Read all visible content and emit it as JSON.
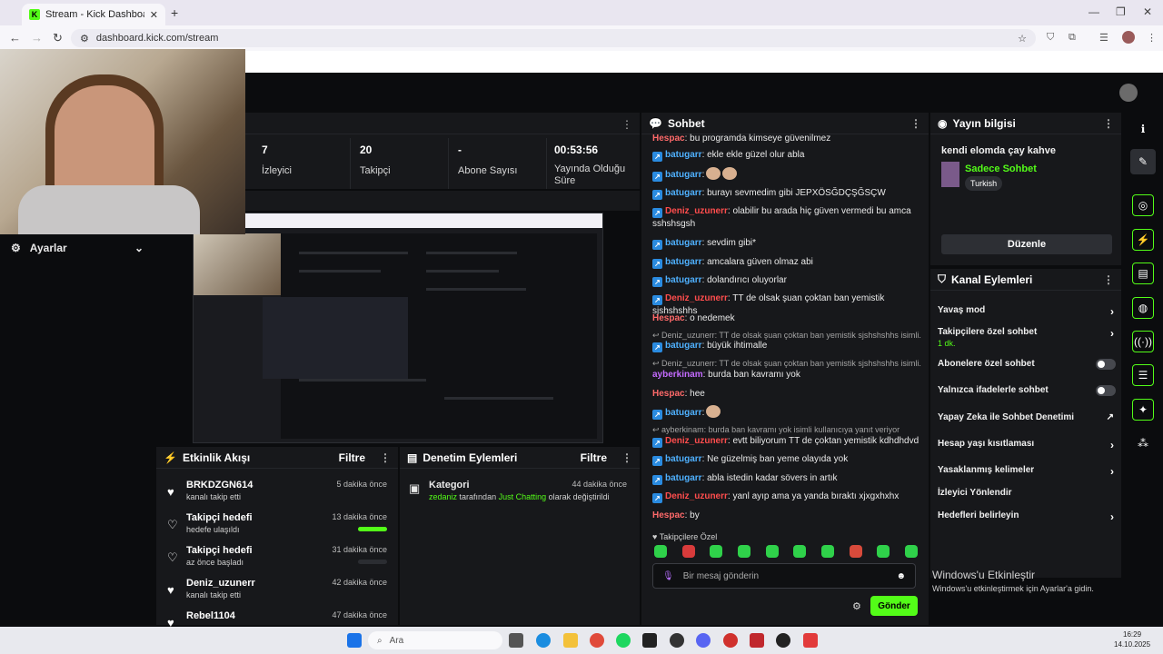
{
  "browser": {
    "tab_title": "Stream - Kick Dashboard",
    "url": "dashboard.kick.com/stream"
  },
  "stats": [
    {
      "value": "7",
      "label": "İzleyici"
    },
    {
      "value": "20",
      "label": "Takipçi"
    },
    {
      "value": "-",
      "label": "Abone Sayısı"
    },
    {
      "value": "00:53:56",
      "label": "Yayında Olduğu Süre"
    }
  ],
  "sidebar": {
    "settings_label": "Ayarlar"
  },
  "activity": {
    "title": "Etkinlik Akışı",
    "filter": "Filtre",
    "items": [
      {
        "name": "BRKDZGN614",
        "sub": "kanalı takip etti",
        "time": "5 dakika önce",
        "progress": null
      },
      {
        "name": "Takipçi hedefi",
        "sub": "hedefe ulaşıldı",
        "time": "13 dakika önce",
        "progress": 1.0
      },
      {
        "name": "Takipçi hedefi",
        "sub": "az önce başladı",
        "time": "31 dakika önce",
        "progress": 0.0
      },
      {
        "name": "Deniz_uzunerr",
        "sub": "kanalı takip etti",
        "time": "42 dakika önce",
        "progress": null
      },
      {
        "name": "Rebel1104",
        "sub": "",
        "time": "47 dakika önce",
        "progress": null
      }
    ]
  },
  "modactions": {
    "title": "Denetim Eylemleri",
    "filter": "Filtre",
    "item": {
      "name": "Kategori",
      "time": "44 dakika önce",
      "user": "zedaniz",
      "by": "tarafından",
      "category": "Just Chatting",
      "rest": "olarak değiştirildi"
    }
  },
  "chat": {
    "title": "Sohbet",
    "messages": [
      {
        "user": "Hespac",
        "cls": "u-hes",
        "badge": false,
        "text": ": bu programda kimseye güvenilmez"
      },
      {
        "user": "batugarr",
        "cls": "u-bat",
        "badge": true,
        "text": ": ekle ekle güzel olur abla"
      },
      {
        "user": "batugarr",
        "cls": "u-bat",
        "badge": true,
        "text": ":"
      },
      {
        "user": "batugarr",
        "cls": "u-bat",
        "badge": true,
        "text": ": burayı sevmedim gibi JEPXÖSĞDÇŞĞSÇW"
      },
      {
        "user": "Deniz_uzunerr",
        "cls": "u-den",
        "badge": true,
        "text": ": olabilir bu arada hiç güven vermedi bu amca sshshsgsh"
      },
      {
        "user": "batugarr",
        "cls": "u-bat",
        "badge": true,
        "text": ": sevdim gibi*"
      },
      {
        "user": "batugarr",
        "cls": "u-bat",
        "badge": true,
        "text": ": amcalara güven olmaz abi"
      },
      {
        "user": "batugarr",
        "cls": "u-bat",
        "badge": true,
        "text": ": dolandırıcı oluyorlar"
      },
      {
        "user": "Deniz_uzunerr",
        "cls": "u-den",
        "badge": true,
        "text": ": TT de olsak şuan çoktan ban yemistik sjshshshhs"
      },
      {
        "user": "Hespac",
        "cls": "u-hes",
        "badge": false,
        "text": ": o nedemek"
      },
      {
        "user": "batugarr",
        "cls": "u-bat",
        "badge": true,
        "text": ": büyük ihtimalle"
      },
      {
        "user": "ayberkinam",
        "cls": "u-ayb",
        "badge": false,
        "text": ": burda ban kavramı yok"
      },
      {
        "user": "Hespac",
        "cls": "u-hes",
        "badge": false,
        "text": ": hee"
      },
      {
        "user": "batugarr",
        "cls": "u-bat",
        "badge": true,
        "text": ":"
      },
      {
        "user": "Deniz_uzunerr",
        "cls": "u-den",
        "badge": true,
        "text": ": evtt biliyorum TT de çoktan yemistik kdhdhdvd"
      },
      {
        "user": "batugarr",
        "cls": "u-bat",
        "badge": true,
        "text": ": Ne güzelmiş ban yeme olayıda yok"
      },
      {
        "user": "batugarr",
        "cls": "u-bat",
        "badge": true,
        "text": ": abla istedin kadar sövers in artık"
      },
      {
        "user": "Deniz_uzunerr",
        "cls": "u-den",
        "badge": true,
        "text": ": yanl ayıp ama ya yanda bıraktı xjxgxhxhx"
      },
      {
        "user": "Hespac",
        "cls": "u-hes",
        "badge": false,
        "text": ": by"
      }
    ],
    "replies": [
      "Deniz_uzunerr: TT de olsak şuan çoktan ban yemistik sjshshshhs isimli...",
      "Deniz_uzunerr: TT de olsak şuan çoktan ban yemistik sjshshshhs isimli...",
      "ayberkinam: burda ban kavramı yok isimli kullanıcıya yanıt veriyor"
    ],
    "subonly": "Takipçilere Özel",
    "placeholder": "Bir mesaj gönderin",
    "send": "Gönder"
  },
  "info": {
    "title": "Yayın bilgisi",
    "stream_title": "kendi elomda çay kahve",
    "category": "Sadece Sohbet",
    "tag": "Turkish",
    "edit": "Düzenle"
  },
  "channel_actions": {
    "title": "Kanal Eylemleri",
    "slow": "Yavaş mod",
    "followers": "Takipçilere özel sohbet",
    "followers_sub": "1 dk.",
    "subs": "Abonelere özel sohbet",
    "emotes": "Yalnızca ifadelerle sohbet",
    "ai": "Yapay Zeka ile Sohbet Denetimi",
    "age": "Hesap yaşı kısıtlaması",
    "banned": "Yasaklanmış kelimeler",
    "raid": "İzleyici Yönlendir",
    "goals": "Hedefleri belirleyin"
  },
  "windows": {
    "activate_title": "Windows'u Etkinleştir",
    "activate_sub": "Windows'u etkinleştirmek için Ayarlar'a gidin.",
    "search": "Ara",
    "time": "16:29",
    "date": "14.10.2025"
  },
  "colors": {
    "accent": "#53fc18",
    "panel": "#17181b",
    "bg": "#0b0c0e"
  }
}
